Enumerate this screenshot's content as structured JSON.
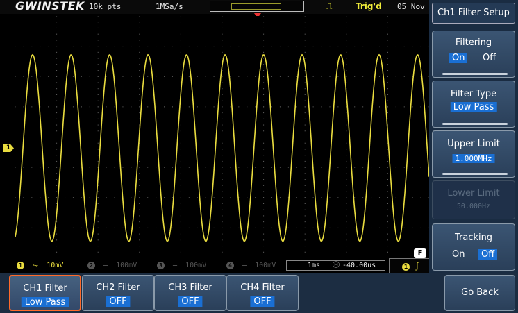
{
  "header": {
    "brand": "GWINSTEK",
    "record_length": "10k pts",
    "sample_rate": "1MSa/s",
    "trigger_state": "Trig'd",
    "date": "05 Nov"
  },
  "channels": [
    {
      "num": "1",
      "scale": "10mV"
    },
    {
      "num": "2",
      "scale": "100mV"
    },
    {
      "num": "3",
      "scale": "100mV"
    },
    {
      "num": "4",
      "scale": "100mV"
    }
  ],
  "timebase": {
    "scale": "1ms",
    "position": "-40.00us"
  },
  "trigger": {
    "channel": "1"
  },
  "f_badge": "F",
  "side_menu": {
    "title": "Ch1 Filter Setup",
    "filtering": {
      "label": "Filtering",
      "on": "On",
      "off": "Off",
      "selected": "On"
    },
    "filter_type": {
      "label": "Filter Type",
      "value": "Low Pass"
    },
    "upper_limit": {
      "label": "Upper Limit",
      "value": "1.000MHz"
    },
    "lower_limit": {
      "label": "Lower Limit",
      "value": "50.000Hz"
    },
    "tracking": {
      "label": "Tracking",
      "on": "On",
      "off": "Off",
      "selected": "Off"
    }
  },
  "bottom_menu": [
    {
      "label": "CH1 Filter",
      "value": "Low Pass"
    },
    {
      "label": "CH2 Filter",
      "value": "OFF"
    },
    {
      "label": "CH3 Filter",
      "value": "OFF"
    },
    {
      "label": "CH4 Filter",
      "value": "OFF"
    }
  ],
  "go_back": "Go Back",
  "colors": {
    "ch1": "#e9dc3f",
    "accent": "#1a6fd3",
    "selected_border": "#ff6a2a"
  },
  "waveform": {
    "channel": 1,
    "cycles": 11
  }
}
